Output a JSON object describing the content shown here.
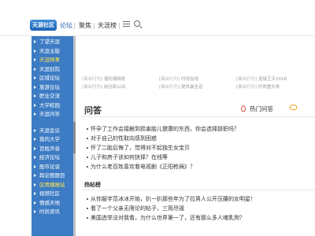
{
  "header": {
    "logo_text": "天涯社区",
    "logo_sub": "论坛",
    "nav": [
      "聚焦",
      "天涯榜"
    ],
    "icons": [
      "list-icon",
      "search-icon"
    ]
  },
  "sidebar": {
    "items": [
      {
        "label": "了望天涯",
        "active": false
      },
      {
        "label": "天涯主版",
        "active": false
      },
      {
        "label": "天涯网事",
        "active": true
      },
      {
        "label": "天涯别院",
        "active": false
      },
      {
        "label": "区域论坛",
        "active": false
      },
      {
        "label": "旅游论坛",
        "active": false
      },
      {
        "label": "职业交流",
        "active": false
      },
      {
        "label": "大学校园",
        "active": false
      },
      {
        "label": "天涯问答",
        "active": false
      },
      {
        "label": "天涯会议",
        "active": false
      },
      {
        "label": "我的大学",
        "active": false
      },
      {
        "label": "百姓声音",
        "active": false
      },
      {
        "label": "经济论坛",
        "active": false
      },
      {
        "label": "股市论谈",
        "active": false
      },
      {
        "label": "舆论图题目",
        "active": false
      },
      {
        "label": "区情播报站",
        "active": true
      },
      {
        "label": "视频社区",
        "active": false
      },
      {
        "label": "情感天地",
        "active": false
      },
      {
        "label": "时尚资讯",
        "active": false
      }
    ]
  },
  "ad_links": [
    {
      "tag": "[商业行为]",
      "text": "摇码捐相处"
    },
    {
      "tag": "[商业行为]",
      "text": "前往新公出"
    },
    {
      "tag": "[商业行为]",
      "text": "时尚在线"
    },
    {
      "tag": "[商业行为]",
      "text": "提供最全运"
    },
    {
      "tag": "[商业行为]",
      "text": "财立游戏"
    },
    {
      "tag": "[商业行为]",
      "text": "数字最新风采"
    },
    {
      "tag": "[商业行为]",
      "text": "连接王天2018"
    },
    {
      "tag": "[商业行为]",
      "text": "时尚童头条"
    }
  ],
  "qa": {
    "title": "问答",
    "hot_label": "热门问答",
    "items": [
      "怀孕了工作会接触到损害胎儿健康的东西，你会选择辞职吗？",
      "对于自己的性取向感到困惑",
      "怀了二胎后悔了，觉得对不起独生女宝贝",
      "儿子和房子该如何抉择？在线等",
      "为什么老百姓喜欢看电视剧《正阳枪祸》？"
    ]
  },
  "forum": {
    "title": "热帖榜",
    "items": [
      "从你服字范冰冰开始，扒一扒那些年为了拉男人公开压腰的女明星！",
      "看了一个父亲无限论的帖子，三观尽毁",
      "美国选举没对我看，为什么世界第一了，还有那么多人哺乳狗？"
    ]
  }
}
